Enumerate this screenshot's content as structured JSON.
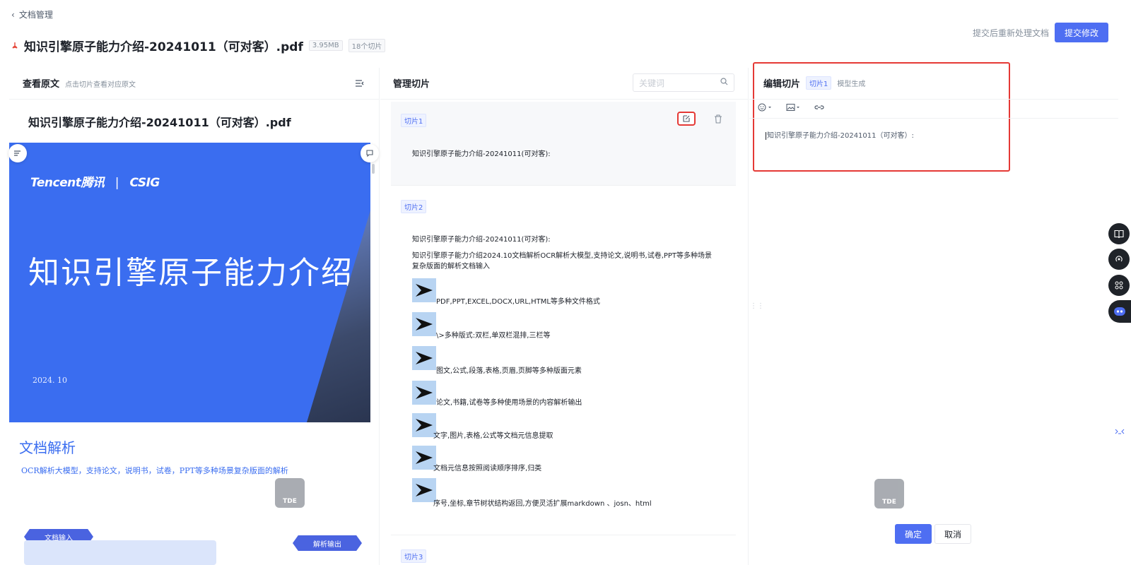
{
  "header": {
    "back_label": "文档管理",
    "doc_title": "知识引擎原子能力介绍-20241011（可对客）.pdf",
    "file_size": "3.95MB",
    "slice_count": "18个切片",
    "reprocess_hint": "提交后重新处理文档",
    "submit_label": "提交修改"
  },
  "left_panel": {
    "title": "查看原文",
    "subtitle": "点击切片查看对应原文",
    "preview_title": "知识引擎原子能力介绍-20241011（可对客）.pdf",
    "slide": {
      "brand": "Tencent腾讯",
      "brand_sep": "|",
      "brand2": "CSIG",
      "heading": "知识引擎原子能力介绍",
      "date": "2024. 10"
    },
    "section": {
      "title": "文档解析",
      "desc": "OCR解析大模型，支持论文，说明书，试卷，PPT等多种场景复杂版面的解析",
      "tag_input": "文档输入",
      "tag_output": "解析输出"
    }
  },
  "mid_panel": {
    "title": "管理切片",
    "search_placeholder": "关键词",
    "slices": [
      {
        "tag": "切片1",
        "text": "知识引擎原子能力介绍-20241011(可对客):"
      },
      {
        "tag": "切片2",
        "lines": [
          "知识引擎原子能力介绍-20241011(可对客):",
          "知识引擎原子能力介绍2024.10文档解析OCR解析大模型,支持论文,说明书,试卷,PPT等多种场景复杂版面的解析文档输入"
        ],
        "bullets": [
          "PDF,PPT,EXCEL,DOCX,URL,HTML等多种文件格式",
          "\\>多种版式:双栏,单双栏混排,三栏等",
          "图文,公式,段落,表格,页眉,页脚等多种版面元素",
          "论文,书籍,试卷等多种使用场景的内容解析输出",
          "文字,图片,表格,公式等文档元信息提取",
          "文档元信息按照阅读顺序排序,归类",
          "序号,坐标,章节树状结构返回,方便灵活扩展markdown 、josn、html"
        ]
      },
      {
        "tag": "切片3"
      }
    ]
  },
  "right_panel": {
    "title": "编辑切片",
    "tag": "切片1",
    "meta": "模型生成",
    "editor_text": "知识引擎原子能力介绍-20241011（可对客）:",
    "ok_label": "确定",
    "cancel_label": "取消",
    "watermark": "TDE"
  },
  "icons": {
    "back": "chevron-left-icon",
    "pdf": "pdf-icon",
    "menu": "collapse-menu-icon",
    "search": "search-icon",
    "edit": "edit-icon",
    "delete": "trash-icon",
    "emoji": "emoji-icon",
    "image": "image-icon",
    "link": "link-icon"
  },
  "colors": {
    "primary": "#4e6ef2",
    "highlight": "#e53935",
    "slide_blue": "#3a6df0"
  }
}
